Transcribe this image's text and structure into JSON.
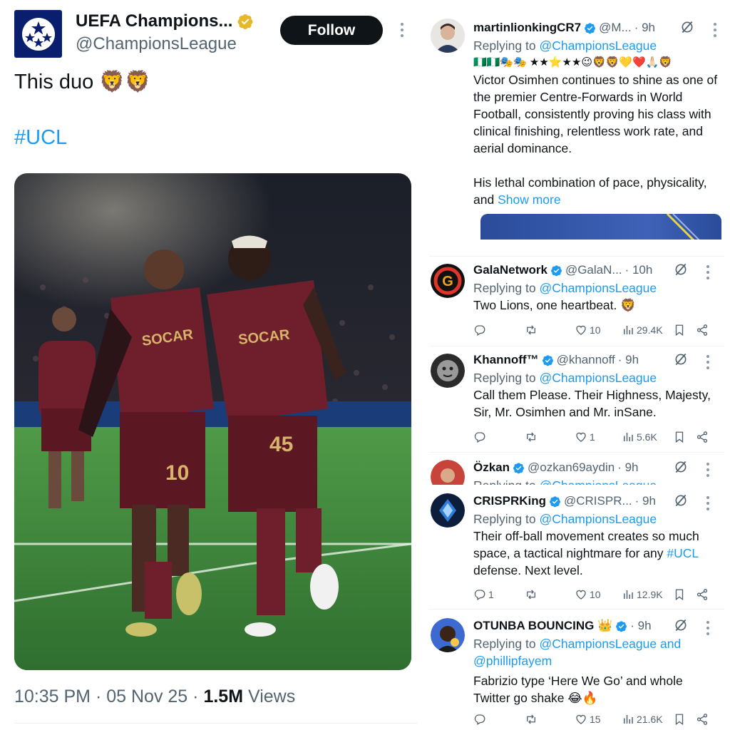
{
  "tweet": {
    "author_name": "UEFA Champions...",
    "author_handle": "@ChampionsLeague",
    "follow_label": "Follow",
    "text": "This duo 🦁🦁",
    "hashtag": "#UCL",
    "time": "10:35 PM",
    "date": "05 Nov 25",
    "views_count": "1.5M",
    "views_label": "Views",
    "separator": "·",
    "photo": {
      "sponsor": "SOCAR",
      "numbers": [
        "10",
        "45"
      ]
    }
  },
  "colors": {
    "accent": "#1d9bf0",
    "text": "#0f1419",
    "muted": "#536471",
    "jersey": "#6e1f2b",
    "pitch": "#3f8a3a",
    "gold_badge": "#e8b829"
  },
  "replies": [
    {
      "name": "martinlionkingCR7",
      "handle": "@M...",
      "time": "· 9h",
      "replying_prefix": "Replying to",
      "replying_to": "@ChampionsLeague",
      "emoji_line": "🇳🇬🇳🇬🎭🎭 ★★⭐★★😉🦁🦁💛❤️🙏🏻🦁",
      "text": "Victor Osimhen continues to shine as one of the premier Centre-Forwards in World Football, consistently proving his class with clinical finishing, relentless work rate, and aerial dominance.",
      "text2": "His lethal combination of pace, physicality, and",
      "show_more": "Show more"
    },
    {
      "name": "GalaNetwork",
      "handle": "@GalaN...",
      "time": "· 10h",
      "replying_prefix": "Replying to",
      "replying_to": "@ChampionsLeague",
      "text": "Two Lions, one heartbeat. 🦁",
      "stats": {
        "replies": "",
        "reposts": "",
        "likes": "10",
        "views": "29.4K"
      }
    },
    {
      "name": "Khannoff™",
      "handle": "@khannoff",
      "time": "· 9h",
      "replying_prefix": "Replying to",
      "replying_to": "@ChampionsLeague",
      "text": "Call them Please. Their Highness, Majesty, Sir, Mr. Osimhen and Mr. inSane.",
      "stats": {
        "replies": "",
        "reposts": "",
        "likes": "1",
        "views": "5.6K"
      }
    },
    {
      "name": "Özkan",
      "handle": "@ozkan69aydin",
      "time": "· 9h",
      "replying_prefix": "Replying to",
      "replying_to": "@ChampionsLeague"
    },
    {
      "name": "CRISPRKing",
      "handle": "@CRISPR...",
      "time": "· 9h",
      "replying_prefix": "Replying to",
      "replying_to": "@ChampionsLeague",
      "text_a": "Their off-ball movement creates so much space, a tactical nightmare for any",
      "hashtag": "#UCL",
      "text_b": "defense. Next level.",
      "stats": {
        "replies": "1",
        "reposts": "",
        "likes": "10",
        "views": "12.9K"
      }
    },
    {
      "name": "OTUNBA BOUNCING 👑",
      "handle": "",
      "time": "· 9h",
      "replying_prefix": "Replying to",
      "replying_to": "@ChampionsLeague",
      "replying_and": "and",
      "replying_to2": "@phillipfayem",
      "text": "Fabrizio type ‘Here We Go’ and whole Twitter go shake 😂🔥",
      "stats": {
        "replies": "",
        "reposts": "",
        "likes": "15",
        "views": "21.6K"
      }
    }
  ],
  "icons": {
    "verified_gold": "verified-gold-badge-icon",
    "verified_blue": "verified-blue-badge-icon",
    "grok": "grok-slash-icon",
    "more": "more-vertical-icon",
    "reply": "reply-icon",
    "repost": "repost-icon",
    "like": "heart-icon",
    "views": "views-chart-icon",
    "bookmark": "bookmark-icon",
    "share": "share-icon"
  }
}
